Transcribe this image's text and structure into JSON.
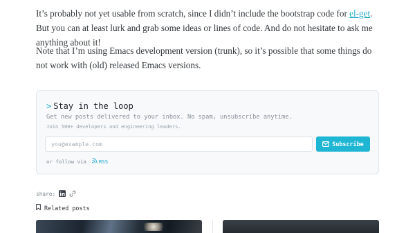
{
  "article": {
    "para1_before_link": "It’s probably not yet usable from scratch, since I didn’t include the bootstrap code for ",
    "para1_link": "el-get",
    "para1_after_link": ". But you can at least lurk and grab some ideas or lines of code. And do not hesitate to ask me anything about it!",
    "para2": "Note that I’m using Emacs development version (trunk), so it’s possible that some things do not work with (old) released Emacs versions."
  },
  "newsletter": {
    "prompt": ">",
    "title": "Stay in the loop",
    "description": "Get new posts delivered to your inbox. No spam, unsubscribe anytime.",
    "subtext": "Join 500+ developers and engineering leaders.",
    "email_placeholder": "you@example.com",
    "subscribe_label": "Subscribe",
    "follow_text": "or follow via",
    "rss_label": "RSS"
  },
  "share": {
    "label": "share:",
    "icons": [
      "linkedin-icon",
      "link-icon"
    ]
  },
  "related": {
    "heading": "Related posts"
  },
  "colors": {
    "accent": "#1fb6d3",
    "link": "#1fa7c7",
    "card_bg": "#f7f9fb"
  }
}
